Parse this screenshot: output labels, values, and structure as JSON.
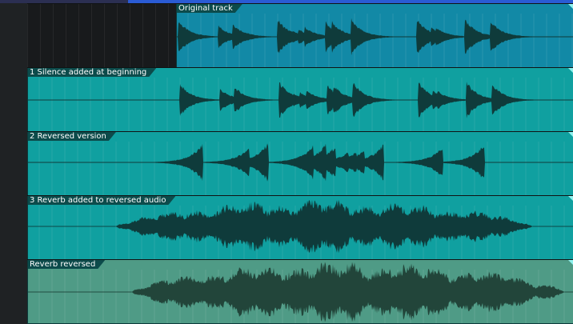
{
  "colors": {
    "clip_original": "#1289a6",
    "clip_teal": "#10a0a0",
    "clip_green": "#4f9b86",
    "wave_dark": "#0f3b3b",
    "wave_green": "#22453a"
  },
  "tracks": [
    {
      "label": "Original track"
    },
    {
      "label": "1 Silence added at beginning"
    },
    {
      "label": "2 Reversed version"
    },
    {
      "label": "3 Reverb added to reversed audio"
    },
    {
      "label": "Reverb reversed"
    }
  ]
}
